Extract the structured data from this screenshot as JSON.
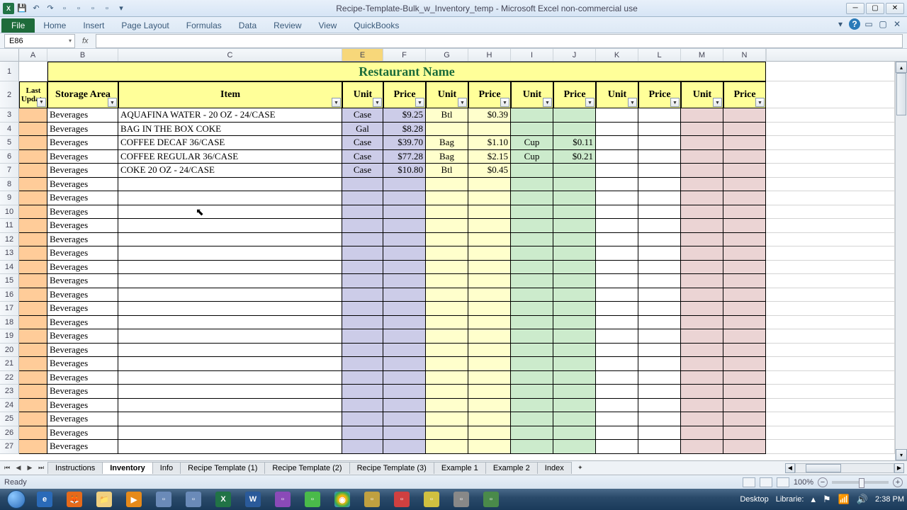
{
  "titlebar": {
    "title": "Recipe-Template-Bulk_w_Inventory_temp - Microsoft Excel non-commercial use"
  },
  "ribbon": {
    "file": "File",
    "tabs": [
      "Home",
      "Insert",
      "Page Layout",
      "Formulas",
      "Data",
      "Review",
      "View",
      "QuickBooks"
    ]
  },
  "namebox": "E86",
  "columns": [
    "A",
    "B",
    "C",
    "E",
    "F",
    "G",
    "H",
    "I",
    "J",
    "K",
    "L",
    "M",
    "N"
  ],
  "selected_col": "E",
  "row_numbers": [
    1,
    2,
    3,
    4,
    5,
    6,
    7,
    8,
    9,
    10,
    11,
    12,
    13,
    14,
    15,
    16,
    17,
    18,
    19,
    20,
    21,
    22,
    23,
    24,
    25,
    26,
    27
  ],
  "sheet_title": "Restaurant Name",
  "headers": {
    "last_update": "Last Update",
    "storage_area": "Storage Area",
    "item": "Item",
    "unit": "Unit",
    "price": "Price"
  },
  "rows": [
    {
      "area": "Beverages",
      "item": "AQUAFINA WATER - 20 OZ - 24/CASE",
      "u1": "Case",
      "p1": "$9.25",
      "u2": "Btl",
      "p2": "$0.39",
      "u3": "",
      "p3": "",
      "u4": "",
      "p4": ""
    },
    {
      "area": "Beverages",
      "item": "BAG IN THE BOX COKE",
      "u1": "Gal",
      "p1": "$8.28",
      "u2": "",
      "p2": "",
      "u3": "",
      "p3": "",
      "u4": "",
      "p4": ""
    },
    {
      "area": "Beverages",
      "item": "COFFEE DECAF 36/CASE",
      "u1": "Case",
      "p1": "$39.70",
      "u2": "Bag",
      "p2": "$1.10",
      "u3": "Cup",
      "p3": "$0.11",
      "u4": "",
      "p4": ""
    },
    {
      "area": "Beverages",
      "item": "COFFEE REGULAR 36/CASE",
      "u1": "Case",
      "p1": "$77.28",
      "u2": "Bag",
      "p2": "$2.15",
      "u3": "Cup",
      "p3": "$0.21",
      "u4": "",
      "p4": ""
    },
    {
      "area": "Beverages",
      "item": "COKE 20 OZ - 24/CASE",
      "u1": "Case",
      "p1": "$10.80",
      "u2": "Btl",
      "p2": "$0.45",
      "u3": "",
      "p3": "",
      "u4": "",
      "p4": ""
    },
    {
      "area": "Beverages",
      "item": "",
      "u1": "",
      "p1": "",
      "u2": "",
      "p2": "",
      "u3": "",
      "p3": "",
      "u4": "",
      "p4": ""
    },
    {
      "area": "Beverages",
      "item": "",
      "u1": "",
      "p1": "",
      "u2": "",
      "p2": "",
      "u3": "",
      "p3": "",
      "u4": "",
      "p4": ""
    },
    {
      "area": "Beverages",
      "item": "",
      "u1": "",
      "p1": "",
      "u2": "",
      "p2": "",
      "u3": "",
      "p3": "",
      "u4": "",
      "p4": ""
    },
    {
      "area": "Beverages",
      "item": "",
      "u1": "",
      "p1": "",
      "u2": "",
      "p2": "",
      "u3": "",
      "p3": "",
      "u4": "",
      "p4": ""
    },
    {
      "area": "Beverages",
      "item": "",
      "u1": "",
      "p1": "",
      "u2": "",
      "p2": "",
      "u3": "",
      "p3": "",
      "u4": "",
      "p4": ""
    },
    {
      "area": "Beverages",
      "item": "",
      "u1": "",
      "p1": "",
      "u2": "",
      "p2": "",
      "u3": "",
      "p3": "",
      "u4": "",
      "p4": ""
    },
    {
      "area": "Beverages",
      "item": "",
      "u1": "",
      "p1": "",
      "u2": "",
      "p2": "",
      "u3": "",
      "p3": "",
      "u4": "",
      "p4": ""
    },
    {
      "area": "Beverages",
      "item": "",
      "u1": "",
      "p1": "",
      "u2": "",
      "p2": "",
      "u3": "",
      "p3": "",
      "u4": "",
      "p4": ""
    },
    {
      "area": "Beverages",
      "item": "",
      "u1": "",
      "p1": "",
      "u2": "",
      "p2": "",
      "u3": "",
      "p3": "",
      "u4": "",
      "p4": ""
    },
    {
      "area": "Beverages",
      "item": "",
      "u1": "",
      "p1": "",
      "u2": "",
      "p2": "",
      "u3": "",
      "p3": "",
      "u4": "",
      "p4": ""
    },
    {
      "area": "Beverages",
      "item": "",
      "u1": "",
      "p1": "",
      "u2": "",
      "p2": "",
      "u3": "",
      "p3": "",
      "u4": "",
      "p4": ""
    },
    {
      "area": "Beverages",
      "item": "",
      "u1": "",
      "p1": "",
      "u2": "",
      "p2": "",
      "u3": "",
      "p3": "",
      "u4": "",
      "p4": ""
    },
    {
      "area": "Beverages",
      "item": "",
      "u1": "",
      "p1": "",
      "u2": "",
      "p2": "",
      "u3": "",
      "p3": "",
      "u4": "",
      "p4": ""
    },
    {
      "area": "Beverages",
      "item": "",
      "u1": "",
      "p1": "",
      "u2": "",
      "p2": "",
      "u3": "",
      "p3": "",
      "u4": "",
      "p4": ""
    },
    {
      "area": "Beverages",
      "item": "",
      "u1": "",
      "p1": "",
      "u2": "",
      "p2": "",
      "u3": "",
      "p3": "",
      "u4": "",
      "p4": ""
    },
    {
      "area": "Beverages",
      "item": "",
      "u1": "",
      "p1": "",
      "u2": "",
      "p2": "",
      "u3": "",
      "p3": "",
      "u4": "",
      "p4": ""
    },
    {
      "area": "Beverages",
      "item": "",
      "u1": "",
      "p1": "",
      "u2": "",
      "p2": "",
      "u3": "",
      "p3": "",
      "u4": "",
      "p4": ""
    },
    {
      "area": "Beverages",
      "item": "",
      "u1": "",
      "p1": "",
      "u2": "",
      "p2": "",
      "u3": "",
      "p3": "",
      "u4": "",
      "p4": ""
    },
    {
      "area": "Beverages",
      "item": "",
      "u1": "",
      "p1": "",
      "u2": "",
      "p2": "",
      "u3": "",
      "p3": "",
      "u4": "",
      "p4": ""
    },
    {
      "area": "Beverages",
      "item": "",
      "u1": "",
      "p1": "",
      "u2": "",
      "p2": "",
      "u3": "",
      "p3": "",
      "u4": "",
      "p4": ""
    }
  ],
  "sheets": [
    "Instructions",
    "Inventory",
    "Info",
    "Recipe Template (1)",
    "Recipe Template (2)",
    "Recipe Template (3)",
    "Example 1",
    "Example 2",
    "Index"
  ],
  "active_sheet": "Inventory",
  "status": {
    "ready": "Ready",
    "zoom": "100%"
  },
  "taskbar": {
    "desktop": "Desktop",
    "libraries": "Librarie:",
    "time": "2:38 PM"
  }
}
